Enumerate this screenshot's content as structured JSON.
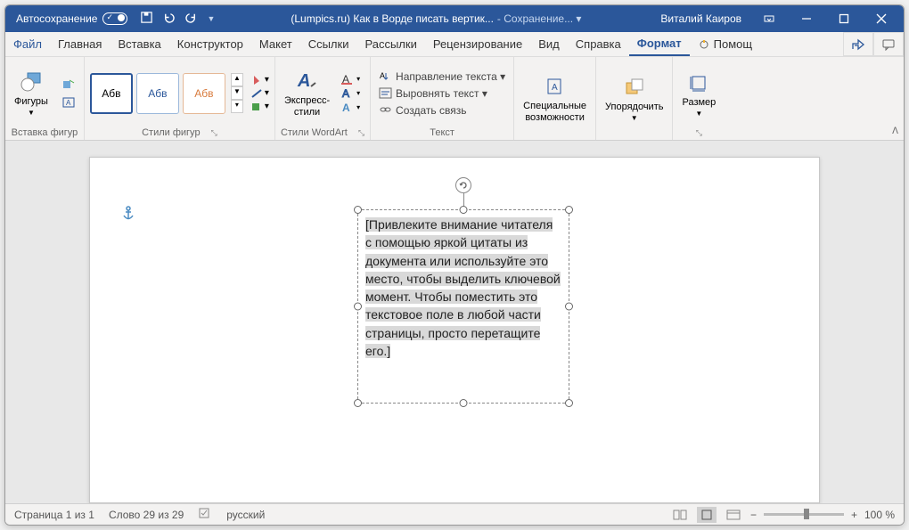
{
  "titlebar": {
    "autosave": "Автосохранение",
    "doc_title": "(Lumpics.ru) Как в Ворде писать вертик...",
    "saving": "- Сохранение... ▾",
    "user": "Виталий Каиров"
  },
  "tabs": {
    "file": "Файл",
    "home": "Главная",
    "insert": "Вставка",
    "design": "Конструктор",
    "layout": "Макет",
    "references": "Ссылки",
    "mailings": "Рассылки",
    "review": "Рецензирование",
    "view": "Вид",
    "help": "Справка",
    "format": "Формат",
    "tell_me": "Помощ"
  },
  "ribbon": {
    "shapes_insert": {
      "shapes": "Фигуры",
      "label": "Вставка фигур"
    },
    "shape_styles": {
      "sample": "Абв",
      "label": "Стили фигур"
    },
    "wordart": {
      "express": "Экспресс-\nстили",
      "label": "Стили WordArt"
    },
    "text": {
      "direction": "Направление текста ▾",
      "align": "Выровнять текст ▾",
      "link": "Создать связь",
      "label": "Текст"
    },
    "accessibility": {
      "label": "Специальные\nвозможности"
    },
    "arrange": {
      "label": "Упорядочить"
    },
    "size": {
      "label": "Размер"
    }
  },
  "textbox": {
    "content": "[Привлеките внимание читателя с помощью яркой цитаты из документа или используйте это место, чтобы выделить ключевой момент. Чтобы поместить это текстовое поле в любой части страницы, просто перетащите его.]"
  },
  "statusbar": {
    "page": "Страница 1 из 1",
    "words": "Слово 29 из 29",
    "lang": "русский",
    "zoom": "100 %"
  }
}
